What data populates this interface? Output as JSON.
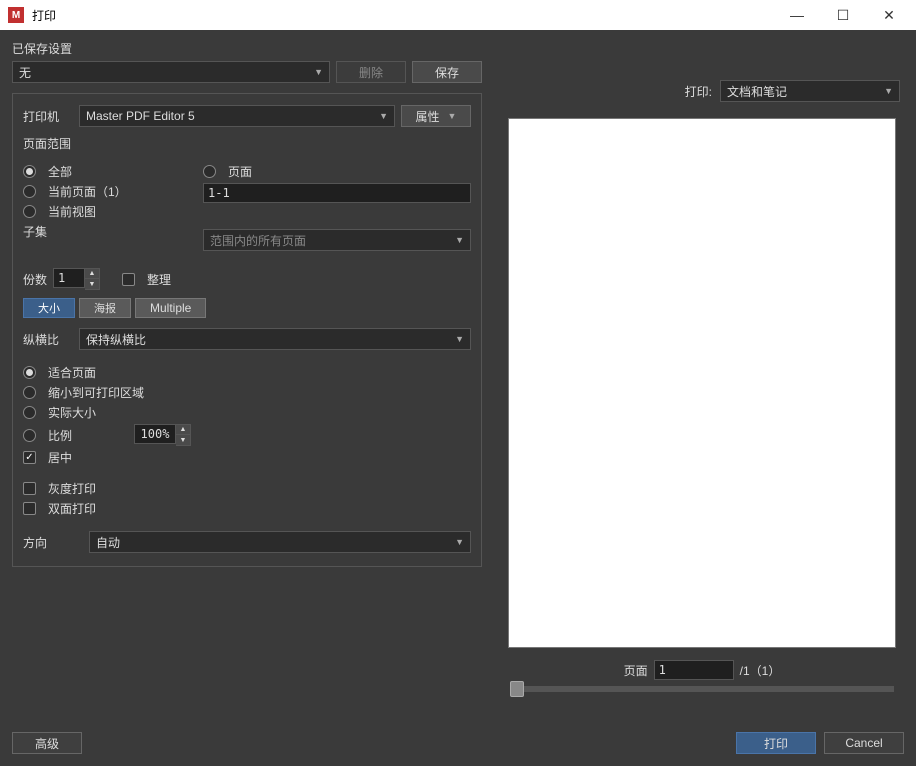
{
  "window": {
    "title": "打印"
  },
  "saved": {
    "label": "已保存设置",
    "preset": "无",
    "delete": "删除",
    "save": "保存"
  },
  "printer": {
    "label": "打印机",
    "name": "Master PDF Editor 5",
    "properties": "属性"
  },
  "page_range": {
    "group": "页面范围",
    "all": "全部",
    "current_page": "当前页面（1）",
    "current_view": "当前视图",
    "pages_label": "页面",
    "pages_value": "1-1",
    "subset_label": "子集",
    "subset_value": "范围内的所有页面"
  },
  "copies": {
    "label": "份数",
    "value": "1",
    "collate": "整理"
  },
  "tabs": {
    "size": "大小",
    "poster": "海报",
    "multiple": "Multiple"
  },
  "aspect": {
    "label": "纵横比",
    "value": "保持纵横比"
  },
  "fit": {
    "fit_page": "适合页面",
    "shrink": "缩小到可打印区域",
    "actual": "实际大小",
    "scale": "比例",
    "scale_value": "100%",
    "center": "居中"
  },
  "misc": {
    "grayscale": "灰度打印",
    "duplex": "双面打印",
    "orientation_label": "方向",
    "orientation_value": "自动"
  },
  "right": {
    "print_label": "打印:",
    "print_what": "文档和笔记",
    "page_label": "页面",
    "page_value": "1",
    "page_total": "/1（1）"
  },
  "buttons": {
    "advanced": "高级",
    "print": "打印",
    "cancel": "Cancel"
  }
}
